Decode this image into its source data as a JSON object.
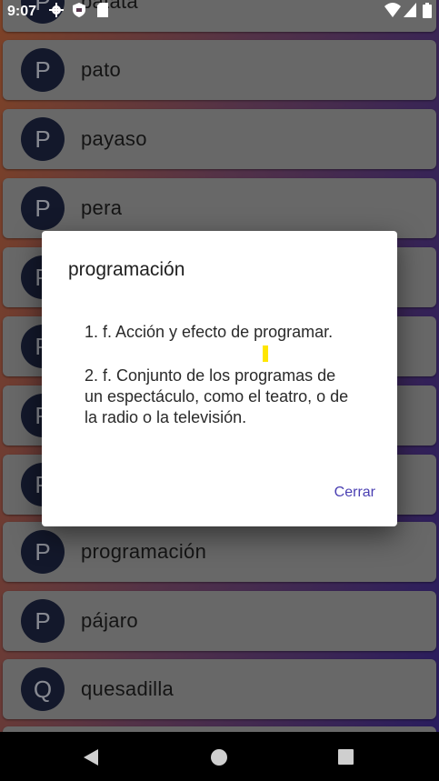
{
  "status_bar": {
    "time": "9:07"
  },
  "list": [
    {
      "initial": "P",
      "word": "patata"
    },
    {
      "initial": "P",
      "word": "pato"
    },
    {
      "initial": "P",
      "word": "payaso"
    },
    {
      "initial": "P",
      "word": "pera"
    },
    {
      "initial": "P",
      "word": ""
    },
    {
      "initial": "P",
      "word": ""
    },
    {
      "initial": "P",
      "word": ""
    },
    {
      "initial": "P",
      "word": ""
    },
    {
      "initial": "P",
      "word": "programación"
    },
    {
      "initial": "P",
      "word": "pájaro"
    },
    {
      "initial": "Q",
      "word": "quesadilla"
    }
  ],
  "dialog": {
    "title": "programación",
    "definitions": [
      "1. f. Acción y efecto de programar.",
      "2. f. Conjunto de los programas de un espectáculo, como el teatro, o de la radio o la televisión."
    ],
    "close_label": "Cerrar"
  }
}
